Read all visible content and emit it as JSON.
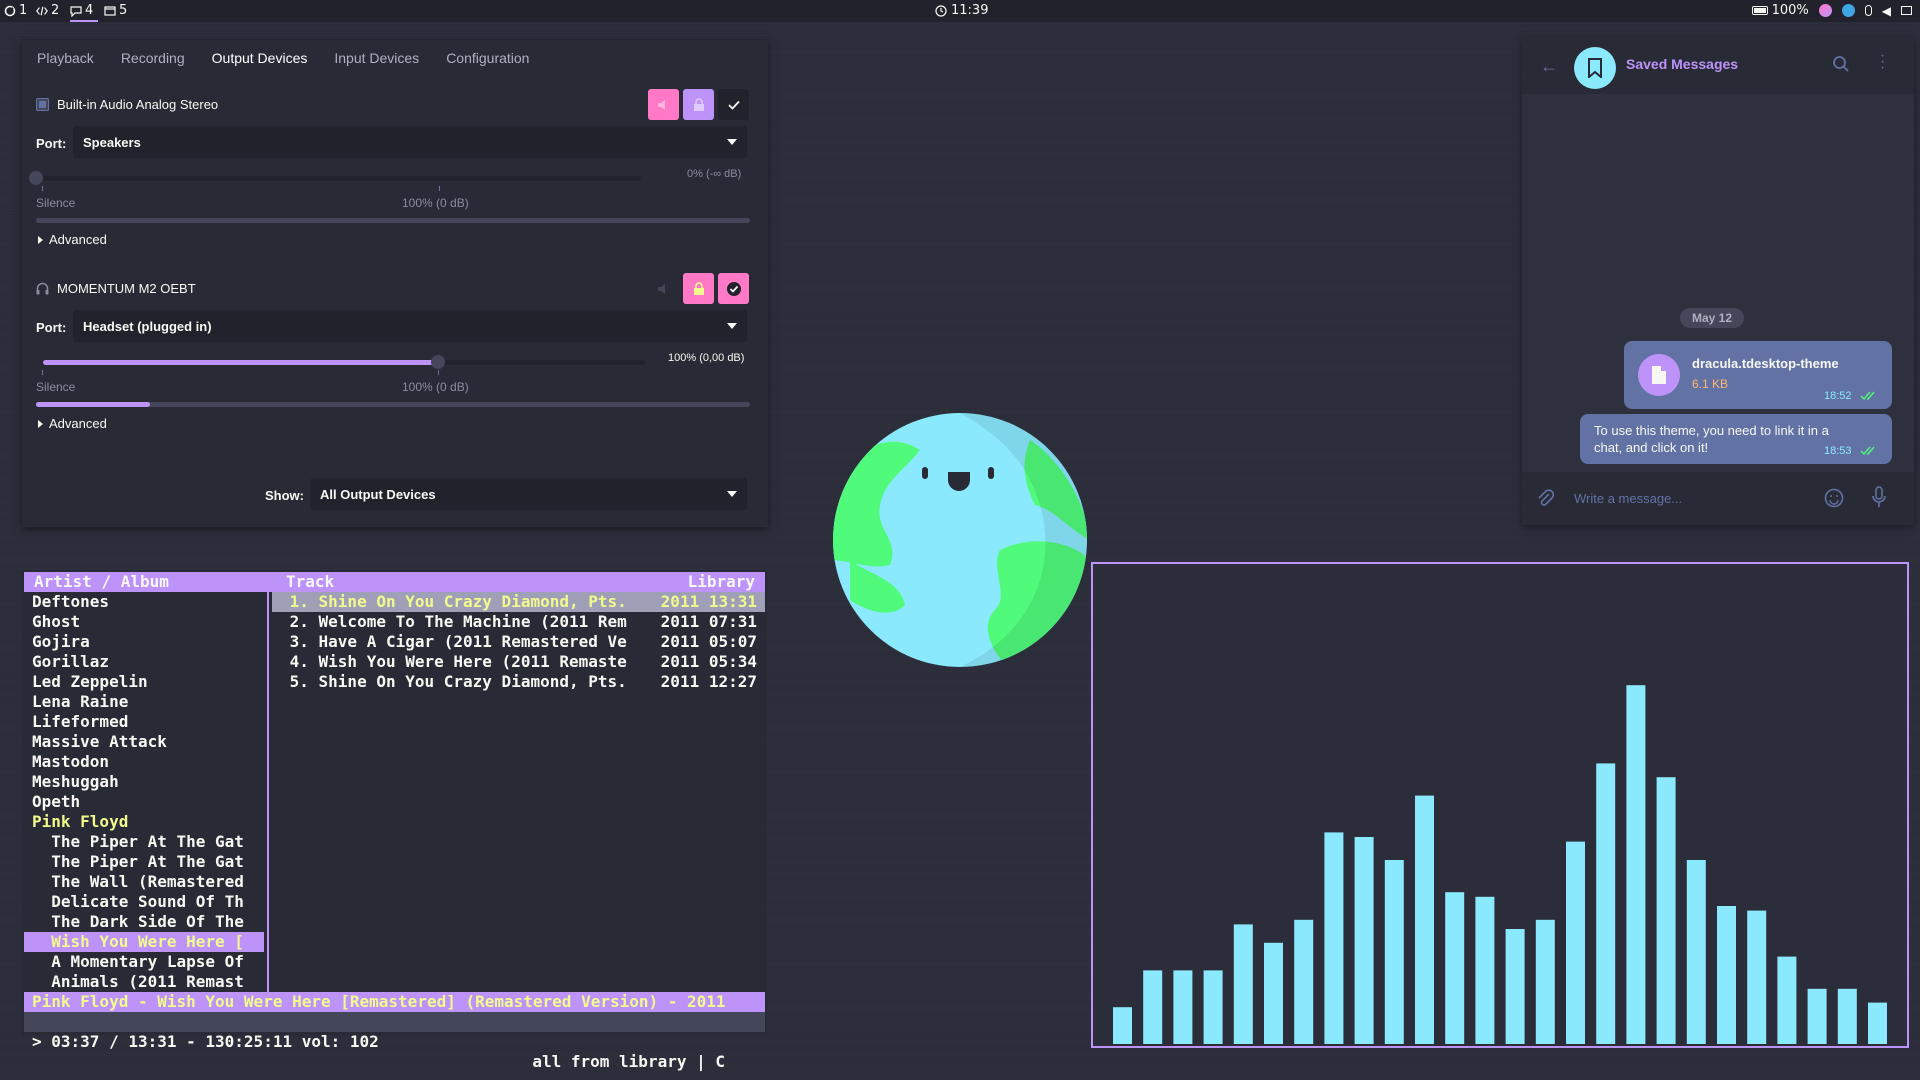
{
  "topbar": {
    "workspaces": [
      {
        "label": "1",
        "icon": "debian-icon"
      },
      {
        "label": "2",
        "icon": "code-icon"
      },
      {
        "label": "4",
        "icon": "chat-icon"
      },
      {
        "label": "5",
        "icon": "window-icon"
      }
    ],
    "clock": "11:39",
    "battery": "100%",
    "colors": {
      "accent": "#bd93f9",
      "bar_bg": "#21222c"
    }
  },
  "pavucontrol": {
    "tabs": [
      "Playback",
      "Recording",
      "Output Devices",
      "Input Devices",
      "Configuration"
    ],
    "active_tab": "Output Devices",
    "devices": [
      {
        "name": "Built-in Audio Analog Stereo",
        "icon": "audio-card-icon",
        "port_label": "Port:",
        "port": "Speakers",
        "volume_text": "0% (-∞ dB)",
        "volume_fraction": 0.0,
        "silence_label": "Silence",
        "ref_label": "100% (0 dB)",
        "meter_fraction": 0.0,
        "advanced_label": "Advanced"
      },
      {
        "name": "MOMENTUM M2 OEBT",
        "icon": "headphones-icon",
        "port_label": "Port:",
        "port": "Headset (plugged in)",
        "volume_text": "100% (0,00 dB)",
        "volume_fraction": 1.0,
        "silence_label": "Silence",
        "ref_label": "100% (0 dB)",
        "meter_fraction": 0.16,
        "advanced_label": "Advanced"
      }
    ],
    "show_label": "Show:",
    "show_value": "All Output Devices"
  },
  "cmus": {
    "headers": {
      "left": "Artist / Album",
      "mid": "Track",
      "right": "Library"
    },
    "artists": [
      "Deftones",
      "Ghost",
      "Gojira",
      "Gorillaz",
      "Led Zeppelin",
      "Lena Raine",
      "Lifeformed",
      "Massive Attack",
      "Mastodon",
      "Meshuggah",
      "Opeth",
      "Pink Floyd",
      "  The Piper At The Gat",
      "  The Piper At The Gat",
      "  The Wall (Remastered",
      "  Delicate Sound Of Th",
      "  The Dark Side Of The",
      "  Wish You Were Here [",
      "  A Momentary Lapse Of",
      "  Animals (2011 Remast"
    ],
    "highlighted_artist_index": 11,
    "selected_album_index": 17,
    "tracks": [
      {
        "title": " 1. Shine On You Crazy Diamond, Pts.",
        "date": "2011 13:31"
      },
      {
        "title": " 2. Welcome To The Machine (2011 Rem",
        "date": "2011 07:31"
      },
      {
        "title": " 3. Have A Cigar (2011 Remastered Ve",
        "date": "2011 05:07"
      },
      {
        "title": " 4. Wish You Were Here (2011 Remaste",
        "date": "2011 05:34"
      },
      {
        "title": " 5. Shine On You Crazy Diamond, Pts.",
        "date": "2011 12:27"
      }
    ],
    "playing_track_index": 0,
    "now_playing": "Pink Floyd - Wish You Were Here [Remastered] (Remastered Version) - 2011",
    "status_left": "> 03:37 / 13:31 - 130:25:11 vol: 102",
    "status_right": "all from library | C"
  },
  "telegram": {
    "title": "Saved Messages",
    "date_badge": "May 12",
    "file": {
      "name": "dracula.tdesktop-theme",
      "size": "6.1 KB",
      "time": "18:52"
    },
    "message": {
      "text": "To use this theme, you need to link it in a chat, and click on it!",
      "time": "18:53"
    },
    "input_placeholder": "Write a message..."
  },
  "visualizer": {
    "colors": {
      "bar": "#8be9fd",
      "border": "#bd93f9"
    }
  },
  "chart_data": {
    "type": "bar",
    "categories": [
      "1",
      "2",
      "3",
      "4",
      "5",
      "6",
      "7",
      "8",
      "9",
      "10",
      "11",
      "12",
      "13",
      "14",
      "15",
      "16",
      "17",
      "18",
      "19",
      "20",
      "21",
      "22",
      "23",
      "24",
      "25",
      "26"
    ],
    "values": [
      8,
      16,
      16,
      16,
      26,
      22,
      27,
      46,
      45,
      40,
      54,
      33,
      32,
      25,
      27,
      44,
      61,
      78,
      58,
      40,
      30,
      29,
      19,
      12,
      12,
      9
    ],
    "title": "",
    "xlabel": "",
    "ylabel": "",
    "ylim": [
      0,
      100
    ],
    "grid": false
  }
}
